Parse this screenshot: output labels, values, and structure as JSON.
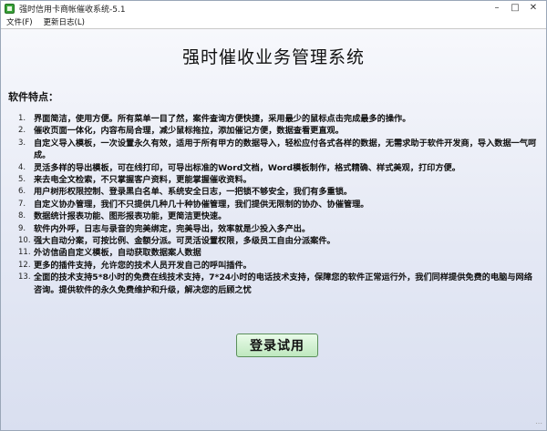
{
  "window": {
    "title": "强时信用卡商帐催收系统-5.1"
  },
  "menu": {
    "items": [
      "文件(F)",
      "更新日志(L)"
    ]
  },
  "main": {
    "title": "强时催收业务管理系统",
    "features_label": "软件特点：",
    "features": [
      "界面简洁，使用方便。所有菜单一目了然，案件查询方便快捷，采用最少的鼠标点击完成最多的操作。",
      "催收页面一体化，内容布局合理，减少鼠标拖拉，添加催记方便，数据查看更直观。",
      "自定义导入模板，一次设置永久有效，适用于所有甲方的数据导入，轻松应付各式各样的数据，无需求助于软件开发商，导入数据一气呵成。",
      "灵活多样的导出模板，可在线打印，可导出标准的Word文档，Word模板制作，格式精确、样式美观，打印方便。",
      "来去电全文检索，不只掌握客户资料，更能掌握催收资料。",
      "用户树形权限控制、登录黑白名单、系统安全日志，一把锁不够安全，我们有多重锁。",
      "自定义协办管理，我们不只提供几种几十种协催管理，我们提供无限制的协办、协催管理。",
      "数据统计报表功能、图形报表功能，更简洁更快速。",
      "软件内外呼，日志与录音的完美绑定，完美导出，效率就是少投入多产出。",
      "强大自动分案，可按比例、金额分派。可灵活设置权限，多级员工自由分派案件。",
      "外访信函自定义模板，自动获取数据案人数据",
      "更多的插件支持，允许您的技术人员开发自己的呼叫插件。",
      "全面的技术支持5*8小时的免费在线技术支持，7*24小时的电话技术支持，保障您的软件正常运行外，我们同样提供免费的电脑与网络咨询。提供软件的永久免费维护和升级，解决您的后顾之忧"
    ],
    "login_button": "登录试用"
  }
}
